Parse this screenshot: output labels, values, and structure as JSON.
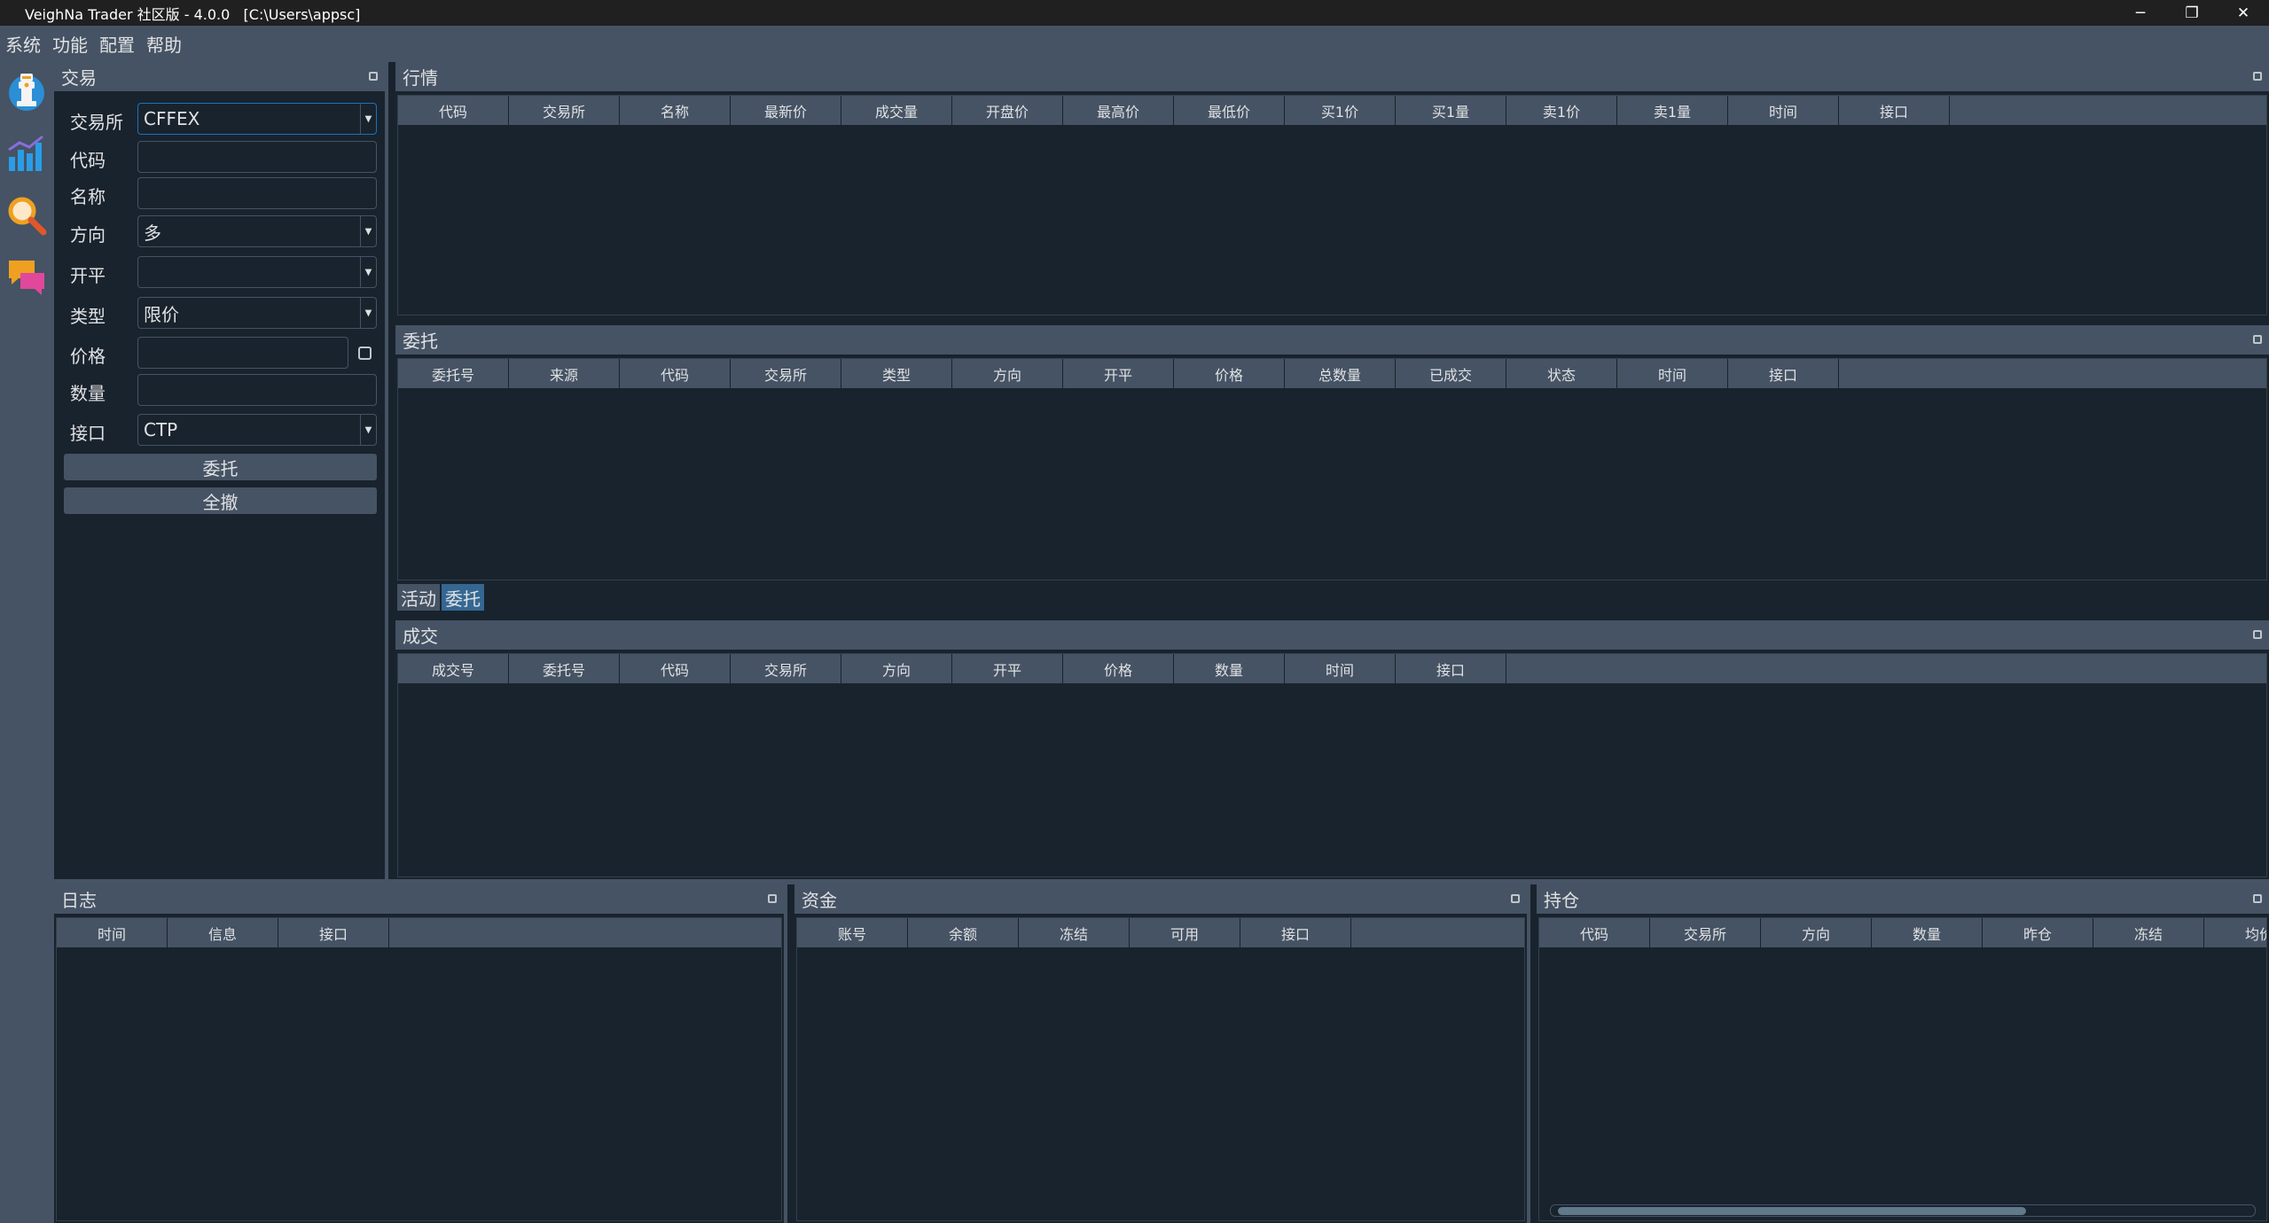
{
  "window": {
    "title": "VeighNa Trader 社区版 - 4.0.0   [C:\\Users\\appsc]",
    "minimize": "─",
    "restore": "❐",
    "close": "✕"
  },
  "menu": [
    "系统",
    "功能",
    "配置",
    "帮助"
  ],
  "toolbar": [
    {
      "icon": "trader-robot-icon"
    },
    {
      "icon": "bar-chart-icon"
    },
    {
      "icon": "magnifier-icon"
    },
    {
      "icon": "chat-bubbles-icon"
    }
  ],
  "trading": {
    "title": "交易",
    "rows": [
      {
        "label": "交易所",
        "value": "CFFEX",
        "kind": "select"
      },
      {
        "label": "代码",
        "value": "",
        "kind": "input"
      },
      {
        "label": "名称",
        "value": "",
        "kind": "input"
      },
      {
        "label": "方向",
        "value": "多",
        "kind": "select"
      },
      {
        "label": "开平",
        "value": "",
        "kind": "select"
      },
      {
        "label": "类型",
        "value": "限价",
        "kind": "select"
      },
      {
        "label": "价格",
        "value": "",
        "kind": "input"
      },
      {
        "label": "数量",
        "value": "",
        "kind": "input"
      },
      {
        "label": "接口",
        "value": "CTP",
        "kind": "select"
      }
    ],
    "send_button": "委托",
    "cancel_all_button": "全撤"
  },
  "tick": {
    "title": "行情",
    "columns": [
      "代码",
      "交易所",
      "名称",
      "最新价",
      "成交量",
      "开盘价",
      "最高价",
      "最低价",
      "买1价",
      "买1量",
      "卖1价",
      "卖1量",
      "时间",
      "接口"
    ]
  },
  "order": {
    "title": "委托",
    "columns": [
      "委托号",
      "来源",
      "代码",
      "交易所",
      "类型",
      "方向",
      "开平",
      "价格",
      "总数量",
      "已成交",
      "状态",
      "时间",
      "接口"
    ],
    "tabs": [
      "活动",
      "委托"
    ]
  },
  "trade": {
    "title": "成交",
    "columns": [
      "成交号",
      "委托号",
      "代码",
      "交易所",
      "方向",
      "开平",
      "价格",
      "数量",
      "时间",
      "接口"
    ]
  },
  "log": {
    "title": "日志",
    "columns": [
      "时间",
      "信息",
      "接口"
    ]
  },
  "account": {
    "title": "资金",
    "columns": [
      "账号",
      "余额",
      "冻结",
      "可用",
      "接口"
    ]
  },
  "position": {
    "title": "持仓",
    "columns": [
      "代码",
      "交易所",
      "方向",
      "数量",
      "昨仓",
      "冻结",
      "均价"
    ]
  }
}
